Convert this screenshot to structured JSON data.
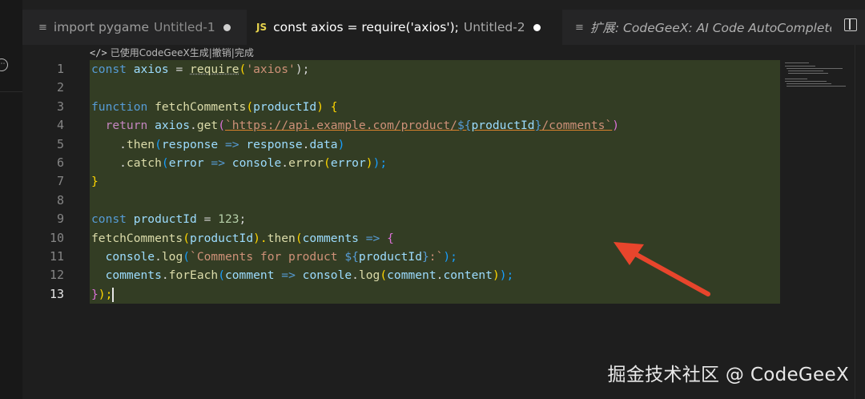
{
  "tabs": [
    {
      "icon": "≡",
      "name": "import pygame",
      "sub": "Untitled-1",
      "dirty": true,
      "active": false
    },
    {
      "icon": "JS",
      "name": "const axios = require('axios');",
      "sub": "Untitled-2",
      "dirty": true,
      "active": true
    },
    {
      "icon": "≡",
      "name": "扩展: CodeGeeX: AI Code AutoComplete",
      "active": false
    }
  ],
  "codelens": {
    "prefix": "已使用CodeGeeX生成",
    "sep": " | ",
    "undo": "撤销",
    "done": "完成"
  },
  "line_numbers": [
    "1",
    "2",
    "3",
    "4",
    "5",
    "6",
    "7",
    "8",
    "9",
    "10",
    "11",
    "12",
    "13"
  ],
  "current_line": "13",
  "code": {
    "l1": {
      "kw": "const",
      "v": " axios ",
      "op": "= ",
      "fn": "require",
      "o": "(",
      "s": "'axios'",
      "c": ");"
    },
    "l3": {
      "kw": "function",
      "sp": " ",
      "fn": "fetchComments",
      "o": "(",
      "p": "productId",
      "c": ") ",
      "b": "{"
    },
    "l4": {
      "ind": "  ",
      "kw": "return",
      "sp": " ",
      "v1": "axios",
      "d": ".",
      "fn": "get",
      "o": "(",
      "s1": "`https://api.example.com/product/",
      "dl": "${",
      "v2": "productId",
      "dr": "}",
      "s2": "/comments`",
      "c": ")"
    },
    "l5": {
      "ind": "    ",
      "d": ".",
      "fn": "then",
      "o": "(",
      "v1": "response",
      "ar": " => ",
      "v2": "response",
      "d2": ".",
      "v3": "data",
      "c": ")"
    },
    "l6": {
      "ind": "    ",
      "d": ".",
      "fn": "catch",
      "o": "(",
      "v1": "error",
      "ar": " => ",
      "v2": "console",
      "d2": ".",
      "fn2": "error",
      "o2": "(",
      "v3": "error",
      "c2": ")",
      "c": ");"
    },
    "l7": {
      "b": "}"
    },
    "l9": {
      "kw": "const",
      "v": " productId ",
      "op": "= ",
      "n": "123",
      "c": ";"
    },
    "l10": {
      "fn": "fetchComments",
      "o": "(",
      "v": "productId",
      "c": ").",
      "fn2": "then",
      "o2": "(",
      "v2": "comments",
      "ar": " => ",
      "b": "{"
    },
    "l11": {
      "ind": "  ",
      "v": "console",
      "d": ".",
      "fn": "log",
      "o": "(",
      "s1": "`Comments for product ",
      "dl": "${",
      "v2": "productId",
      "dr": "}",
      "s2": ":`",
      "c": ");"
    },
    "l12": {
      "ind": "  ",
      "v": "comments",
      "d": ".",
      "fn": "forEach",
      "o": "(",
      "v2": "comment",
      "ar": " => ",
      "v3": "console",
      "d2": ".",
      "fn2": "log",
      "o2": "(",
      "v4": "comment",
      "d3": ".",
      "v5": "content",
      "c2": ")",
      "c": ");"
    },
    "l13": {
      "b": "}",
      "c": ");"
    }
  },
  "watermark": "掘金技术社区 @ CodeGeeX",
  "colors": {
    "arrow": "#e8452c",
    "highlight": "#333d24"
  }
}
